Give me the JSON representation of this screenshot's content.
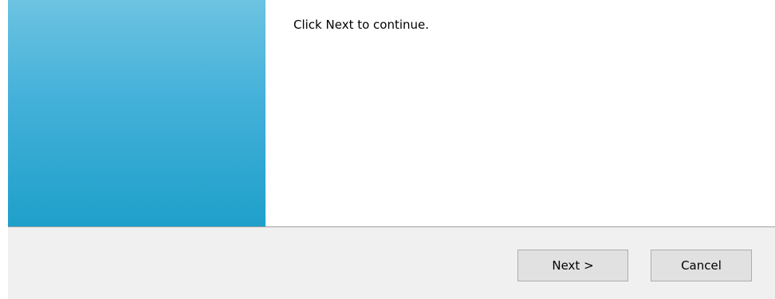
{
  "wizard": {
    "instruction": "Click Next to continue.",
    "banner_colors": [
      "#6cc3e1",
      "#1ea0ca"
    ],
    "buttons": {
      "next_label": "Next >",
      "cancel_label": "Cancel"
    }
  }
}
